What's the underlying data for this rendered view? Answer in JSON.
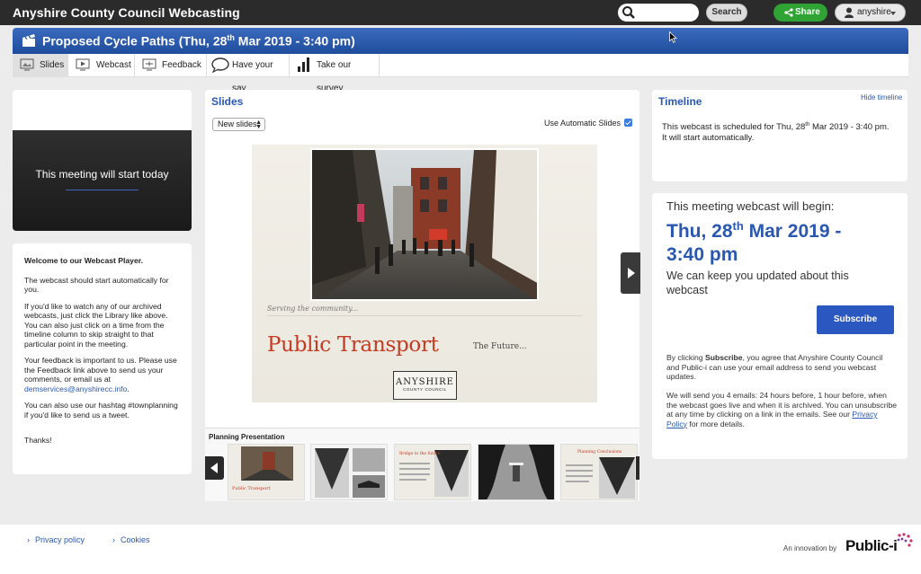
{
  "header": {
    "site_title": "Anyshire County Council Webcasting",
    "search_placeholder": "",
    "search_label": "Search",
    "share_label": "Share",
    "user_name": "anyshire"
  },
  "page": {
    "title_main": "Proposed Cycle Paths (Thu, 28",
    "title_sup": "th",
    "title_end": " Mar 2019 - 3:40 pm)"
  },
  "tabs": [
    {
      "label": "Slides"
    },
    {
      "label": "Webcast"
    },
    {
      "label": "Feedback"
    },
    {
      "label": "Have your say"
    },
    {
      "label": "Take our survey"
    }
  ],
  "video": {
    "status_text": "This meeting will start today"
  },
  "welcome": {
    "title": "Welcome to our Webcast Player.",
    "p1": "The webcast should start automatically for you.",
    "p2": "If you'd like to watch any of our archived webcasts, just click the Library like above. You can also just click on a time from the timeline column to skip straight to that particular point in the meeting.",
    "p3": "Your feedback is important to us. Please use the Feedback link above to send us your comments, or email us at",
    "p3_email": "demservices@anyshirecc.info",
    "p3_end": ".",
    "p4": "You can also use our hashtag #townplanning if you'd like to send us a tweet.",
    "p5": "Thanks!"
  },
  "slides": {
    "heading": "Slides",
    "select_value": "New slides",
    "auto_label": "Use Automatic Slides",
    "slide_serving": "Serving the community...",
    "slide_title": "Public Transport",
    "slide_future": "The Future...",
    "logo_name": "ANYSHIRE",
    "logo_sub": "COUNTY COUNCIL",
    "strip_title": "Planning Presentation",
    "thumbs": [
      {
        "caption": "Public Transport"
      },
      {
        "caption": ""
      },
      {
        "caption": "Bridge to the future"
      },
      {
        "caption": ""
      },
      {
        "caption": "Planning Conclusions"
      }
    ]
  },
  "timeline": {
    "heading": "Timeline",
    "hide_label": "Hide timeline",
    "text_a": "This webcast is scheduled for Thu, 28",
    "text_sup": "th",
    "text_b": " Mar 2019 - 3:40 pm.",
    "text_c": "It will start automatically."
  },
  "subscribe": {
    "begin": "This meeting webcast will begin:",
    "date_a": "Thu, 28",
    "date_sup": "th",
    "date_b": " Mar 2019 -",
    "date_c": "3:40 pm",
    "keep": "We can keep you updated about this webcast",
    "button": "Subscribe",
    "terms_a": "By clicking ",
    "terms_bold": "Subscribe",
    "terms_b": ", you agree that Anyshire County Council and Public-i can use your email address to send you webcast updates.",
    "terms2": "We will send you 4 emails: 24 hours before, 1 hour before, when the webcast goes live and when it is archived. You can unsubscribe at any time by clicking on a link in the emails. See our ",
    "policy_link": "Privacy Policy",
    "terms2_end": " for more details."
  },
  "footer": {
    "privacy": "Privacy policy",
    "cookies": "Cookies",
    "innovation": "An innovation by",
    "brand": "Public-i"
  },
  "colors": {
    "accent": "#2a58b0",
    "share_green": "#2fa333",
    "title_red": "#c43a22"
  }
}
